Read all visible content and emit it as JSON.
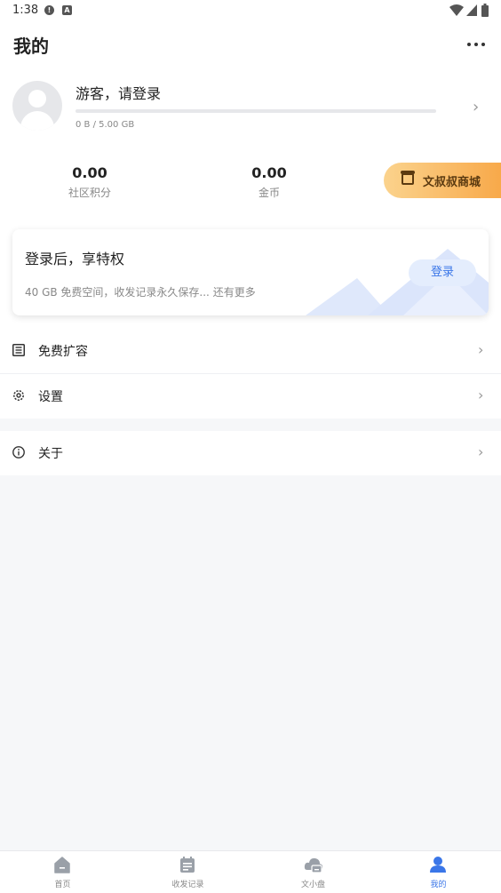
{
  "status_bar": {
    "time": "1:38",
    "notification_icons": [
      "alert-icon",
      "a-icon"
    ],
    "system_icons": [
      "wifi-icon",
      "signal-icon",
      "battery-icon"
    ]
  },
  "header": {
    "title": "我的"
  },
  "profile": {
    "name": "游客，请登录",
    "storage_used_fraction": 0,
    "storage_text": "0 B / 5.00 GB"
  },
  "stats": [
    {
      "value": "0.00",
      "label": "社区积分"
    },
    {
      "value": "0.00",
      "label": "金币"
    }
  ],
  "mall": {
    "label": "文叔叔商城"
  },
  "privilege_card": {
    "title": "登录后，享特权",
    "description": "40 GB 免费空间，收发记录永久保存... 还有更多",
    "login_label": "登录"
  },
  "menu": {
    "expand": {
      "label": "免费扩容",
      "icon": "list-icon"
    },
    "settings": {
      "label": "设置",
      "icon": "gear-icon"
    },
    "about": {
      "label": "关于",
      "icon": "info-icon"
    }
  },
  "bottom_nav": [
    {
      "label": "首页",
      "icon": "home-icon"
    },
    {
      "label": "收发记录",
      "icon": "clipboard-icon"
    },
    {
      "label": "文小盘",
      "icon": "cloud-disk-icon"
    },
    {
      "label": "我的",
      "icon": "person-icon",
      "active": true
    }
  ],
  "colors": {
    "accent": "#3a76e8",
    "mall_gradient_start": "#fbd38d",
    "mall_gradient_end": "#f8a94a"
  }
}
